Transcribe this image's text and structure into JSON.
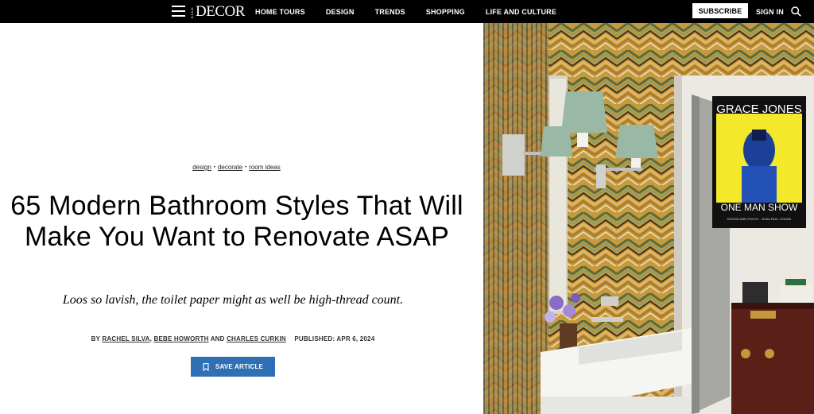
{
  "header": {
    "logo_small": "ELLE",
    "logo_big": "DECOR",
    "nav": [
      "HOME TOURS",
      "DESIGN",
      "TRENDS",
      "SHOPPING",
      "LIFE AND CULTURE"
    ],
    "subscribe_label": "SUBSCRIBE",
    "signin_label": "SIGN IN"
  },
  "article": {
    "tags": [
      "design",
      "decorate",
      "room ideas"
    ],
    "title": "65 Modern Bathroom Styles That Will Make You Want to Renovate ASAP",
    "dek": "Loos so lavish, the toilet paper might as well be high-thread count.",
    "byline_prefix": "BY",
    "authors": [
      "RACHEL SILVA",
      "BEBE HOWORTH",
      "CHARLES CURKIN"
    ],
    "byline_and": "AND",
    "published": "PUBLISHED: APR 6, 2024",
    "save_label": "SAVE ARTICLE"
  },
  "hero": {
    "poster_title": "GRACE JONES",
    "poster_subtitle": "ONE MAN SHOW",
    "poster_credit": "DESIGN AND PHOTO · JEAN-PAUL GOUDE"
  },
  "colors": {
    "nav_bg": "#000000",
    "accent_button": "#2f6fb3",
    "poster_yellow": "#f3e92a"
  },
  "icons": [
    "hamburger-icon",
    "search-icon",
    "bookmark-icon"
  ]
}
